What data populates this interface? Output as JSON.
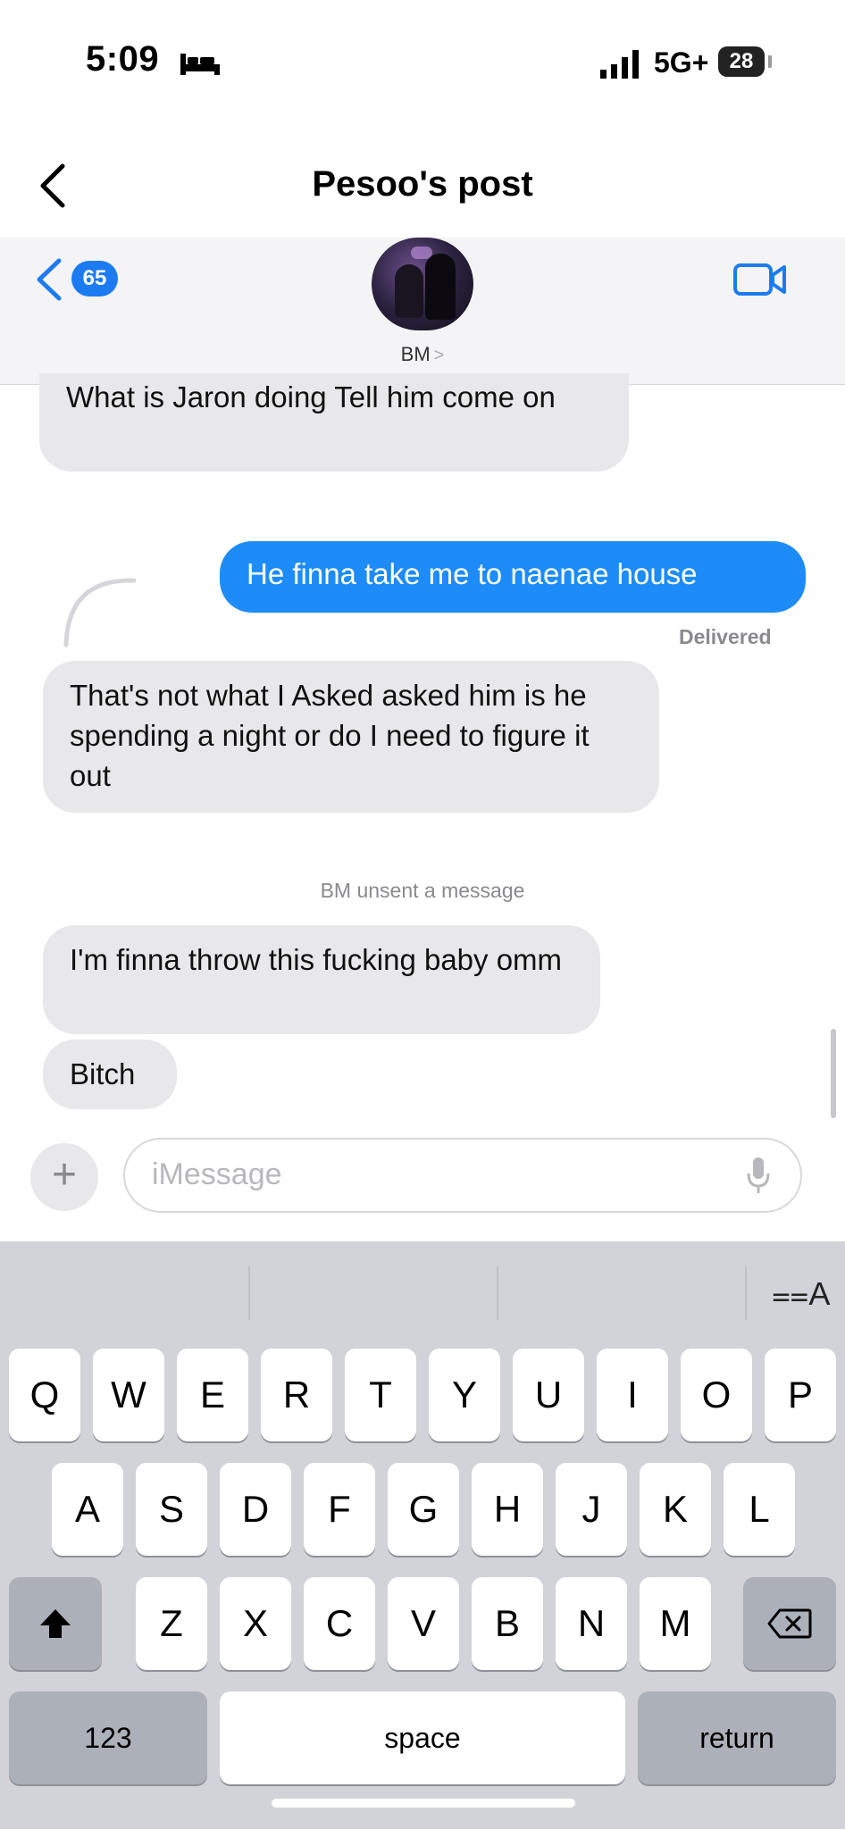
{
  "status_bar": {
    "time": "5:09",
    "network": "5G+",
    "battery": "28"
  },
  "post_nav": {
    "title": "Pesoo's post"
  },
  "message_header": {
    "unread_count": "65",
    "contact_name": "BM",
    "contact_chevron": ">"
  },
  "messages": [
    {
      "direction": "received",
      "text": "What is Jaron doing Tell him come on"
    },
    {
      "direction": "sent",
      "text": "He finna take me to naenae house",
      "status": "Delivered"
    },
    {
      "direction": "received",
      "text": "That's not what I Asked asked him is he spending a night or do I need to figure it out"
    },
    {
      "direction": "system",
      "text": "BM unsent a message"
    },
    {
      "direction": "received",
      "text": "I'm finna throw this fucking baby omm"
    },
    {
      "direction": "received",
      "text": "Bitch"
    }
  ],
  "composer": {
    "plus_label": "+",
    "placeholder": "iMessage"
  },
  "keyboard": {
    "translate_label": "⩵A",
    "row1": [
      "Q",
      "W",
      "E",
      "R",
      "T",
      "Y",
      "U",
      "I",
      "O",
      "P"
    ],
    "row2": [
      "A",
      "S",
      "D",
      "F",
      "G",
      "H",
      "J",
      "K",
      "L"
    ],
    "row3": [
      "Z",
      "X",
      "C",
      "V",
      "B",
      "N",
      "M"
    ],
    "numbers_label": "123",
    "space_label": "space",
    "return_label": "return"
  },
  "colors": {
    "sent_bubble": "#1d8cf8",
    "received_bubble": "#e8e8ea",
    "accent": "#1d7bf2",
    "keyboard_bg": "#d1d3d9"
  }
}
